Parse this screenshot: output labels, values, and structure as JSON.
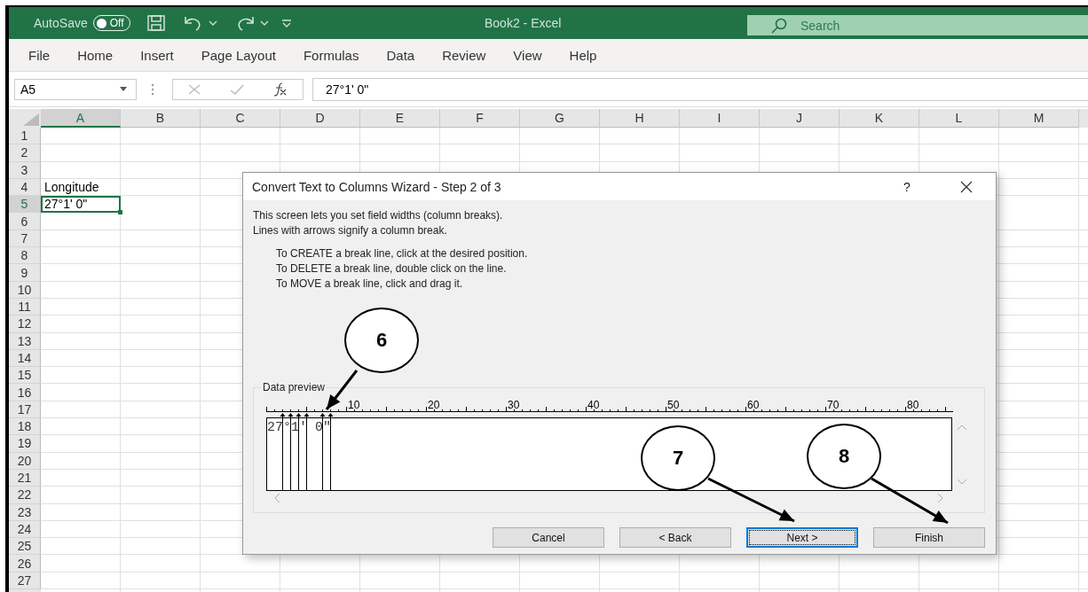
{
  "title_bar": {
    "autosave": {
      "label": "AutoSave",
      "on": false,
      "state_text": "Off"
    },
    "title": "Book2  -  Excel",
    "search": {
      "placeholder": "Search"
    }
  },
  "ribbon_tabs": [
    "File",
    "Home",
    "Insert",
    "Page Layout",
    "Formulas",
    "Data",
    "Review",
    "View",
    "Help"
  ],
  "formula_bar": {
    "name_box": "A5",
    "formula": "27°1' 0\""
  },
  "sheet": {
    "columns": [
      {
        "label": "A",
        "selected": true
      },
      {
        "label": "B",
        "selected": false
      },
      {
        "label": "C",
        "selected": false
      },
      {
        "label": "D",
        "selected": false
      },
      {
        "label": "E",
        "selected": false
      },
      {
        "label": "F",
        "selected": false
      },
      {
        "label": "G",
        "selected": false
      },
      {
        "label": "H",
        "selected": false
      },
      {
        "label": "I",
        "selected": false
      },
      {
        "label": "J",
        "selected": false
      },
      {
        "label": "K",
        "selected": false
      },
      {
        "label": "L",
        "selected": false
      },
      {
        "label": "M",
        "selected": false
      }
    ],
    "rows": [
      {
        "label": "1",
        "selected": false
      },
      {
        "label": "2",
        "selected": false
      },
      {
        "label": "3",
        "selected": false
      },
      {
        "label": "4",
        "selected": false,
        "cells": [
          {
            "text": "Longitude",
            "selected": false
          }
        ]
      },
      {
        "label": "5",
        "selected": true,
        "cells": [
          {
            "text": "27°1' 0\"",
            "selected": true
          }
        ]
      },
      {
        "label": "6",
        "selected": false
      },
      {
        "label": "7",
        "selected": false
      },
      {
        "label": "8",
        "selected": false
      },
      {
        "label": "9",
        "selected": false
      },
      {
        "label": "10",
        "selected": false
      },
      {
        "label": "11",
        "selected": false
      },
      {
        "label": "12",
        "selected": false
      },
      {
        "label": "13",
        "selected": false
      },
      {
        "label": "14",
        "selected": false
      },
      {
        "label": "15",
        "selected": false
      },
      {
        "label": "16",
        "selected": false
      },
      {
        "label": "17",
        "selected": false
      },
      {
        "label": "18",
        "selected": false
      },
      {
        "label": "19",
        "selected": false
      },
      {
        "label": "20",
        "selected": false
      },
      {
        "label": "21",
        "selected": false
      },
      {
        "label": "22",
        "selected": false
      },
      {
        "label": "23",
        "selected": false
      },
      {
        "label": "24",
        "selected": false
      },
      {
        "label": "25",
        "selected": false
      },
      {
        "label": "26",
        "selected": false
      },
      {
        "label": "27",
        "selected": false
      }
    ]
  },
  "dialog": {
    "title": "Convert Text to Columns Wizard - Step 2 of 3",
    "help": "?",
    "intro": [
      "This screen lets you set field widths (column breaks).",
      "Lines with arrows signify a column break."
    ],
    "instructions": [
      "To CREATE a break line, click at the desired position.",
      "To DELETE a break line, double click on the line.",
      "To MOVE a break line, click and drag it."
    ],
    "preview": {
      "label": "Data preview",
      "ruler_labels": [
        "10",
        "20",
        "30",
        "40",
        "50",
        "60",
        "70",
        "80"
      ],
      "lines": [
        "27°1' 0\""
      ]
    },
    "buttons": [
      {
        "label": "Cancel",
        "focused": false
      },
      {
        "label": "< Back",
        "focused": false
      },
      {
        "label": "Next >",
        "focused": true
      },
      {
        "label": "Finish",
        "focused": false
      }
    ]
  },
  "callouts": [
    {
      "label": "6"
    },
    {
      "label": "7"
    },
    {
      "label": "8"
    }
  ]
}
